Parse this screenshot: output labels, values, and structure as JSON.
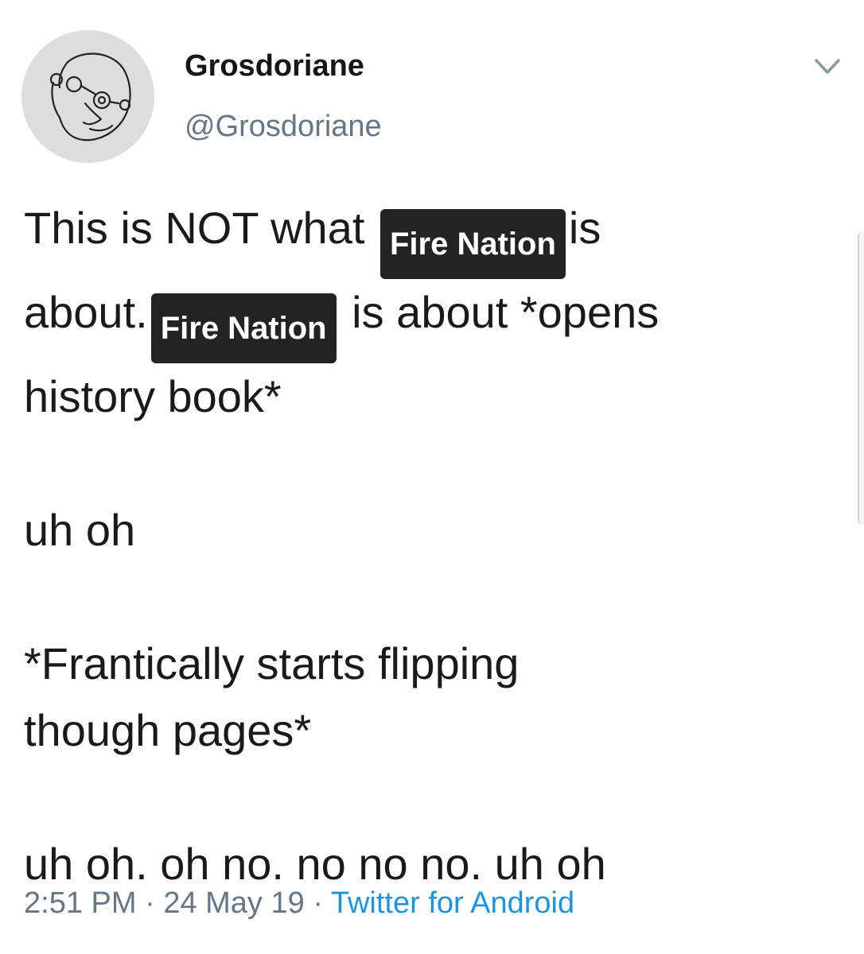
{
  "user": {
    "display_name": "Grosdoriane",
    "handle": "@Grosdoriane"
  },
  "icons": {
    "avatar": "doodle-face-avatar",
    "menu": "chevron-down-icon"
  },
  "tweet": {
    "line1_before": "This is NOT what",
    "tag1": "Fire Nation",
    "line1_after": "is",
    "line2_before": "about.",
    "tag2": "Fire Nation",
    "line2_after": "is about *opens",
    "line3": "history book*",
    "para2": "uh oh",
    "para3_line1": "*Frantically starts flipping",
    "para3_line2": "though pages*",
    "para4": "uh oh. oh no. no no no. uh oh"
  },
  "meta": {
    "time": "2:51 PM",
    "date": "24 May 19",
    "source": "Twitter for Android",
    "separator": "·"
  },
  "colors": {
    "text": "#14171a",
    "muted": "#657786",
    "link": "#1b95e0",
    "tag_bg": "#232323"
  }
}
